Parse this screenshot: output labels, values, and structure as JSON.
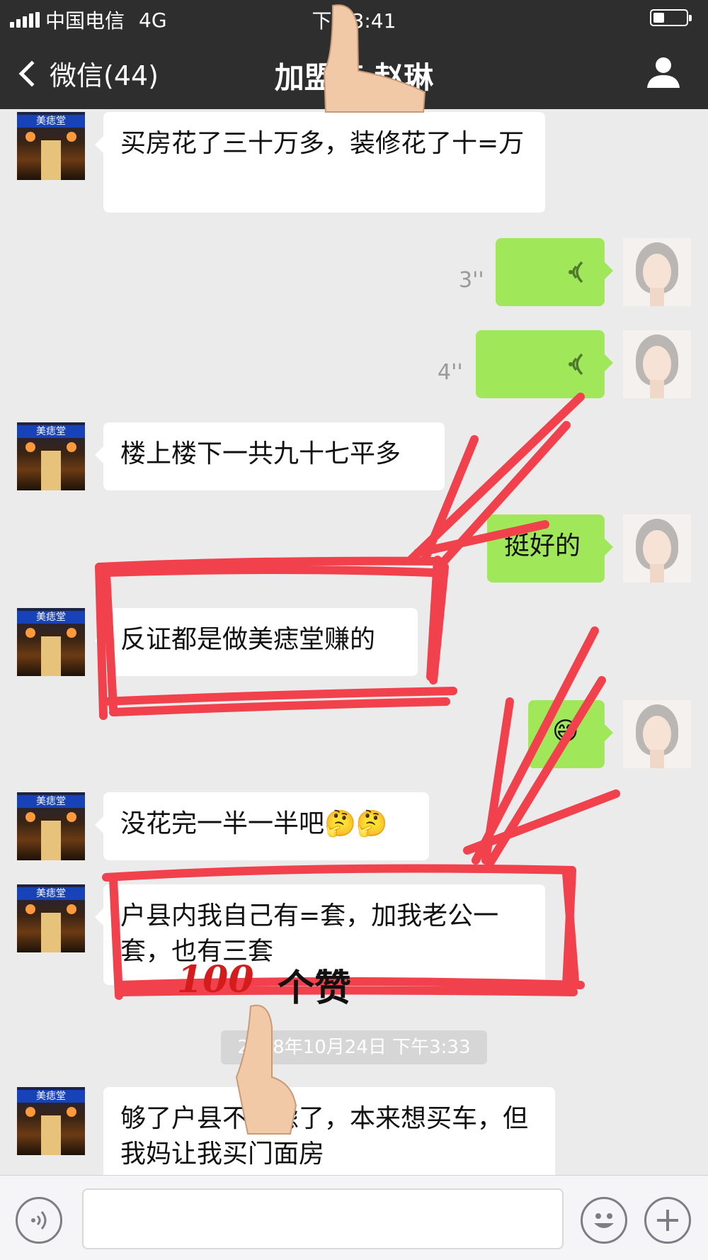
{
  "status_bar": {
    "carrier": "中国电信",
    "network": "4G",
    "time": "下午3:41",
    "battery_level": 0.35
  },
  "nav": {
    "back_label": "微信(44)",
    "title": "加盟商 赵琳"
  },
  "messages": [
    {
      "side": "left",
      "type": "text",
      "text": "买房花了三十万多，装修花了十=万"
    },
    {
      "side": "right",
      "type": "voice",
      "duration": "3''"
    },
    {
      "side": "right",
      "type": "voice",
      "duration": "4''"
    },
    {
      "side": "left",
      "type": "text",
      "text": "楼上楼下一共九十七平多"
    },
    {
      "side": "right",
      "type": "text",
      "text": "挺好的"
    },
    {
      "side": "left",
      "type": "text",
      "text": "反证都是做美痣堂赚的"
    },
    {
      "side": "right",
      "type": "text",
      "text": "😄"
    },
    {
      "side": "left",
      "type": "text",
      "text": "没花完一半一半吧🤔🤔"
    },
    {
      "side": "left",
      "type": "text",
      "text": "户县内我自己有=套，加我老公一套，也有三套"
    },
    {
      "side": "left",
      "type": "text",
      "text": "够了户县不考虑了，本来想买车，但我妈让我买门面房"
    }
  ],
  "timestamp": "2018年10月24日 下午3:33",
  "shop_sign": "美痣堂",
  "annotation": {
    "number": "100",
    "word": "个赞"
  },
  "colors": {
    "nav_bg": "#2e2e2e",
    "chat_bg": "#ebebeb",
    "sent_bubble": "#a0e75a",
    "received_bubble": "#ffffff",
    "annotation_red": "#f0414c"
  },
  "icons": [
    "back-chevron-icon",
    "person-icon",
    "voice-wave-icon",
    "voice-toggle-icon",
    "emoji-icon",
    "plus-icon",
    "thumbs-up-icon"
  ]
}
